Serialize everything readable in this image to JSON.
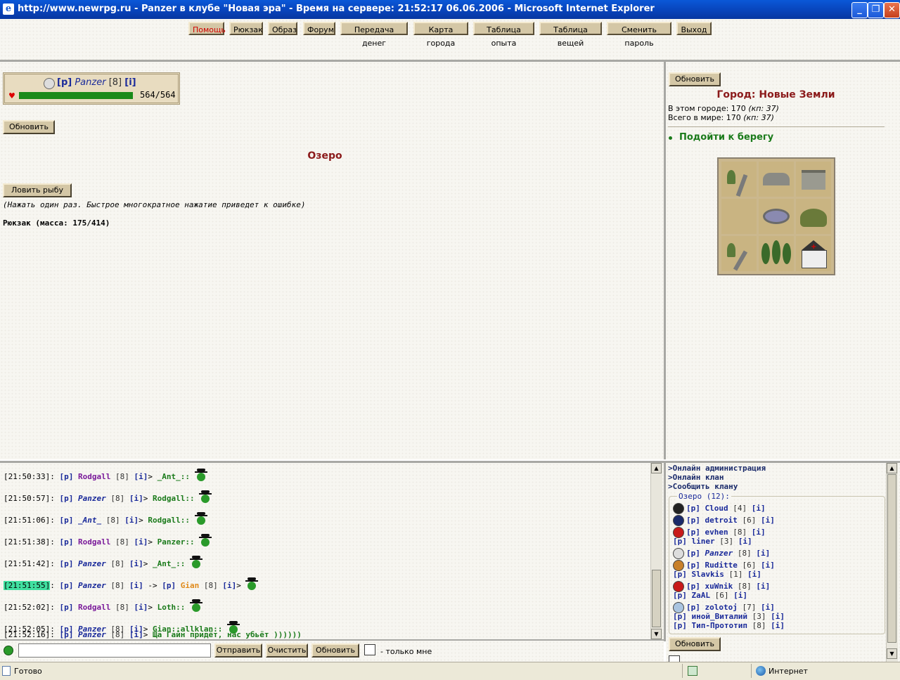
{
  "window": {
    "title": "http://www.newrpg.ru - Panzer в клубе \"Новая эра\" - Время на сервере: 21:52:17 06.06.2006 - Microsoft Internet Explorer",
    "minimize": "_",
    "maximize": "❐",
    "close": "✕"
  },
  "nav": {
    "help": "Помощь",
    "backpack": "Рюкзак",
    "image": "Образ",
    "forum": "Форум",
    "money_transfer": "Передача денег",
    "city_map": "Карта города",
    "exp_table": "Таблица опыта",
    "items_table": "Таблица вещей",
    "change_password": "Сменить пароль",
    "exit": "Выход"
  },
  "player": {
    "p_tag": "[p]",
    "name": "Panzer",
    "level": "[8]",
    "info_tag": "[i]",
    "hp": "564/564",
    "hp_fraction": 1.0
  },
  "main": {
    "refresh": "Обновить",
    "location_title": "Озеро",
    "fish_button": "Ловить рыбу",
    "fish_note": "(Нажать один раз. Быстрое многократное нажатие приведет к ошибке)",
    "backpack_line": "Рюкзак (масса: 175/414)"
  },
  "city": {
    "refresh": "Обновить",
    "title": "Город: Новые Земли",
    "in_city": "В этом городе: 170",
    "in_city_kp": "(кп: 37)",
    "in_world": "Всего в мире: 170",
    "in_world_kp": "(кп: 37)",
    "action": "Подойти к берегу"
  },
  "chat": {
    "messages": [
      {
        "time": "[21:50:33]",
        "name": "Rodgall",
        "level": "[8]",
        "to": "_Ant_::"
      },
      {
        "time": "[21:50:57]",
        "name": "Panzer",
        "level": "[8]",
        "to": "Rodgall::"
      },
      {
        "time": "[21:51:06]",
        "name": "_Ant_",
        "level": "[8]",
        "to": "Rodgall::"
      },
      {
        "time": "[21:51:38]",
        "name": "Rodgall",
        "level": "[8]",
        "to": "Panzer::"
      },
      {
        "time": "[21:51:42]",
        "name": "Panzer",
        "level": "[8]",
        "to": "_Ant_::"
      },
      {
        "time": "[21:51:55]",
        "name": "Panzer",
        "level": "[8]",
        "arrow": "->",
        "target": "Gian",
        "target_level": "[8]"
      },
      {
        "time": "[21:52:02]",
        "name": "Rodgall",
        "level": "[8]",
        "to": "Loth::"
      },
      {
        "time": "[21:52:05]",
        "name": "Panzer",
        "level": "[8]",
        "to": "Gian::allklan::"
      },
      {
        "time": "[21:52:16]",
        "name": "Panzer",
        "level": "[8]",
        "to": "Ща Гайн придёт, нас убьёт ))))))"
      }
    ],
    "p_tag": "[p]",
    "i_tag": "[i]",
    "sep": ">"
  },
  "input_bar": {
    "send": "Отправить",
    "clear": "Очистить",
    "refresh": "Обновить",
    "only_me": "- только мне",
    "message_value": ""
  },
  "online": {
    "admin": ">Онлайн администрация",
    "clan": ">Онлайн клан",
    "tell_clan": ">Сообщить клану",
    "group_title": "Озеро (12):",
    "refresh": "Обновить",
    "users": [
      {
        "name": "Cloud",
        "level": "[4]",
        "icon": "paw-icon"
      },
      {
        "name": "detroit",
        "level": "[6]",
        "icon": "graduation-cap-icon"
      },
      {
        "name": "evhen",
        "level": "[8]",
        "icon": "red-ball-icon"
      },
      {
        "name": "liner",
        "level": "[3]",
        "icon": ""
      },
      {
        "name": "Panzer",
        "level": "[8]",
        "icon": "avatar-icon"
      },
      {
        "name": "Ruditte",
        "level": "[6]",
        "icon": "emblem-icon"
      },
      {
        "name": "Slavkis",
        "level": "[1]",
        "icon": ""
      },
      {
        "name": "xuWnik",
        "level": "[8]",
        "icon": "red-ball-icon"
      },
      {
        "name": "ZaAL",
        "level": "[6]",
        "icon": ""
      },
      {
        "name": "zolotoj",
        "level": "[7]",
        "icon": "ring-icon"
      },
      {
        "name": "иной_Виталий",
        "level": "[3]",
        "icon": ""
      },
      {
        "name": "Тип-Прототип",
        "level": "[8]",
        "icon": ""
      }
    ]
  },
  "status": {
    "ready": "Готово",
    "zone": "Интернет"
  },
  "colors": {
    "hp_bar": "#1a8a1a",
    "location_title": "#8b1a1a",
    "city_action": "#1a7a1a",
    "highlight_time": "#40e0a0"
  }
}
